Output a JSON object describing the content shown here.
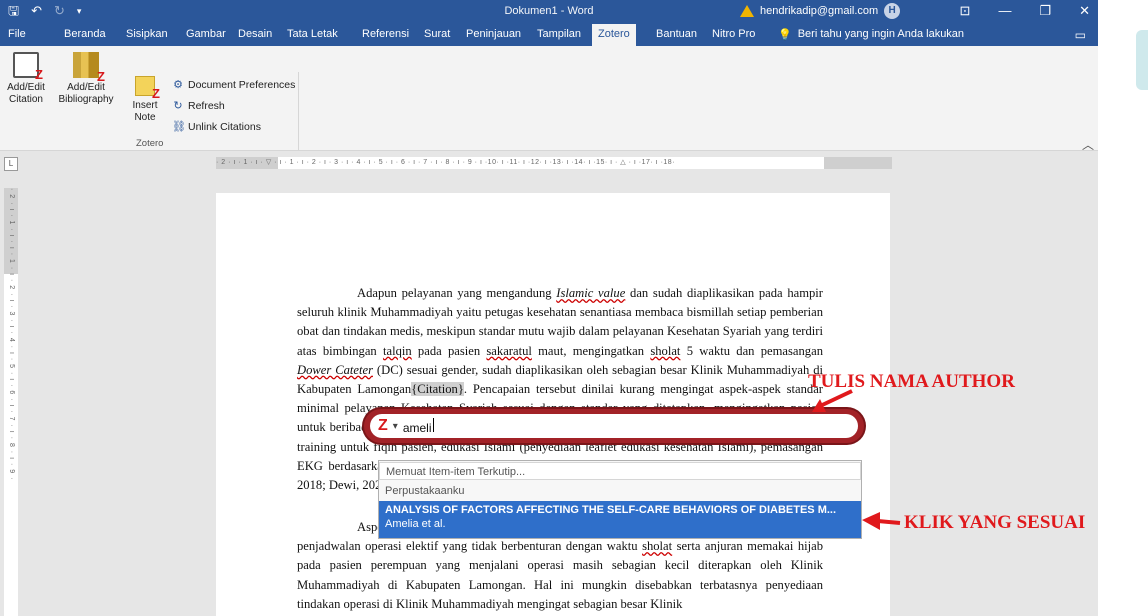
{
  "titlebar": {
    "save_icon": "save-icon",
    "undo_icon": "undo-icon",
    "redo_icon": "redo-icon",
    "doc_title": "Dokumen1 - Word",
    "user_email": "hendrikadip@gmail.com",
    "avatar_initial": "H"
  },
  "tabs": [
    "File",
    "Beranda",
    "Sisipkan",
    "Gambar",
    "Desain",
    "Tata Letak",
    "Referensi",
    "Surat",
    "Peninjauan",
    "Tampilan",
    "Zotero",
    "Bantuan",
    "Nitro Pro"
  ],
  "active_tab": "Zotero",
  "tell_me": "Beri tahu yang ingin Anda lakukan",
  "ribbon": {
    "add_edit_citation": [
      "Add/Edit",
      "Citation"
    ],
    "add_edit_bibliography": [
      "Add/Edit",
      "Bibliography"
    ],
    "insert_note": [
      "Insert",
      "Note"
    ],
    "document_preferences": "Document Preferences",
    "refresh": "Refresh",
    "unlink_citations": "Unlink Citations",
    "group_label": "Zotero"
  },
  "ruler": {
    "corner": "L",
    "horizontal": "· 2 · ı · 1 · ı · ▽ · ı · 1 · ı · 2 · ı · 3 · ı · 4 · ı · 5 · ı · 6 · ı · 7 · ı · 8 · ı · 9 · ı ·10· ı ·11· ı ·12· ı ·13· ı ·14· ı ·15· ı · △ · ı ·17· ı ·18·",
    "vertical": "· 2 · ı · 1 · ı · ı · 1 · ı · 2 · ı · 3 · ı · 4 · ı · 5 · ı · 6 · ı · 7 · ı · 8 · ı · 9 ·"
  },
  "document": {
    "p1_parts": [
      "Adapun pelayanan yang mengandung ",
      "Islamic value",
      " dan sudah diaplikasikan pada hampir seluruh klinik Muhammadiyah yaitu petugas kesehatan senantiasa membaca bismillah setiap pemberian obat dan tindakan medis, meskipun standar mutu wajib dalam pelayanan Kesehatan Syariah yang terdiri atas bimbingan ",
      "talqin",
      " pada pasien ",
      "sakaratul",
      " maut, mengingatkan ",
      "sholat",
      " 5 waktu dan pemasangan ",
      "Dower Cateter",
      " (DC) sesuai gender, sudah diaplikasikan oleh sebagian besar Klinik Muhammadiyah di Kabupaten Lamongan",
      "{Citation}",
      ". Pencapaian tersebut dinilai kurang mengingat aspek-aspek standar minimal pelayanan Kesehatan Syariah sesuai dengan standar yang ditetapkan, mengingatkan pasien untuk beribadah, memberikan pelayanan sesuai gender, perempuan yang menjalani operasi, mandatory training untuk fiqih pasien, edukasi Islami (penyediaan leaflet edukasi kesehatan Islami), pemasangan EKG berdasarkan gender, serta penjadwalan operasi elektif yang tidak pada waktu sholat (Rahmat, 2018; Dewi, 2020; Rochman, 2021)."
    ],
    "p2_parts": [
      "Aspek yang berkaitan dengan tindakan operasi seperti memimpin doa sebelum operasi, penjadwalan operasi elektif yang tidak berbenturan dengan waktu ",
      "sholat",
      " serta anjuran memakai hijab pada pasien perempuan yang menjalani operasi masih sebagian kecil diterapkan oleh Klinik Muhammadiyah di Kabupaten Lamongan. Hal ini mungkin disebabkan terbatasnya penyediaan tindakan operasi di Klinik Muhammadiyah mengingat sebagian besar Klinik"
    ]
  },
  "zotero_qf": {
    "logo": "Z",
    "dropdown_icon": "chevron-down-icon",
    "query": "ameli",
    "section_cited": "Memuat Item-item Terkutip...",
    "section_library": "Perpustakaanku",
    "result_title": "ANALYSIS OF FACTORS AFFECTING THE SELF-CARE BEHAVIORS OF DIABETES M...",
    "result_author": "Amelia et al."
  },
  "annotations": {
    "tulis": "TULIS NAMA AUTHOR",
    "klik": "KLIK YANG SESUAI"
  },
  "colors": {
    "word_blue": "#2b579a",
    "zotero_red": "#a22227",
    "selection_blue": "#2f6fca",
    "annotation_red": "#e0191c"
  }
}
